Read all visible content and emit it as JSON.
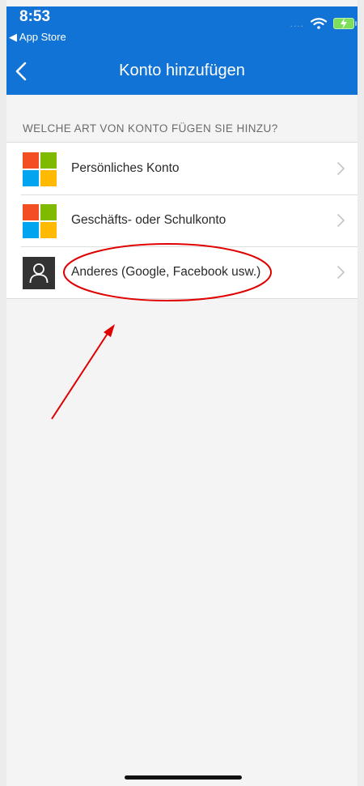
{
  "status_bar": {
    "time": "8:53",
    "back_app": "◀ App Store",
    "signal": "....",
    "icons": [
      "wifi-icon",
      "battery-charging-icon"
    ]
  },
  "nav": {
    "title": "Konto hinzufügen",
    "back_icon": "chevron-left-icon"
  },
  "section_header": "WELCHE ART VON KONTO FÜGEN SIE HINZU?",
  "accounts": [
    {
      "label": "Persönliches Konto",
      "icon": "microsoft-logo-icon"
    },
    {
      "label": "Geschäfts- oder Schulkonto",
      "icon": "microsoft-logo-icon"
    },
    {
      "label": "Anderes (Google, Facebook usw.)",
      "icon": "person-icon"
    }
  ],
  "colors": {
    "nav_blue": "#1173d6",
    "ms_red": "#f25022",
    "ms_green": "#7fba00",
    "ms_blue": "#00a4ef",
    "ms_yellow": "#ffb900",
    "annotation_red": "#e00000",
    "background": "#f4f4f4"
  }
}
